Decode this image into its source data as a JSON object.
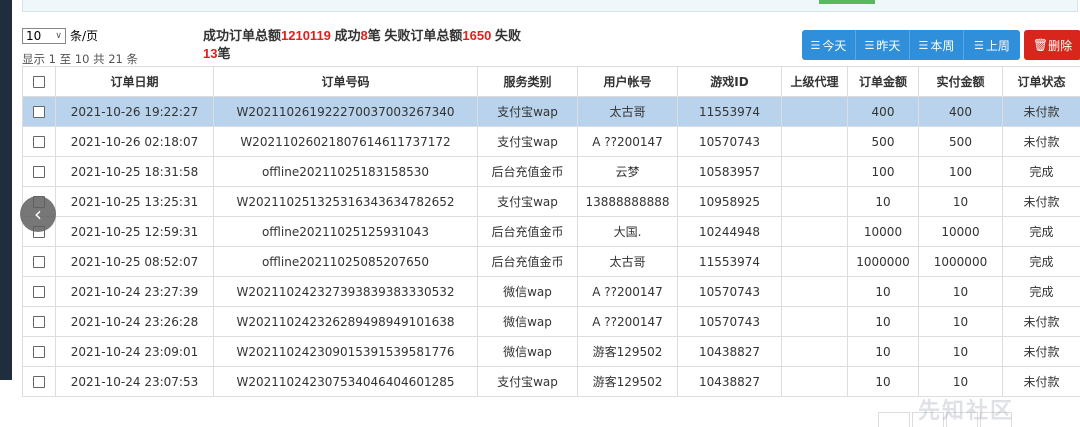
{
  "page_size": {
    "value": "10",
    "label": "条/页"
  },
  "record_info": "显示 1 至 10 共 21 条",
  "summary": {
    "t1": "成功订单总额",
    "success_amount": "1210119",
    "t2": " 成功",
    "success_count": "8",
    "t3": "笔 失败订单总额",
    "fail_amount": "1650",
    "t4": " 失败",
    "fail_count": "13",
    "t5": "笔"
  },
  "filters": {
    "today": "今天",
    "yesterday": "昨天",
    "this_week": "本周",
    "last_week": "上周"
  },
  "delete_label": "删除",
  "columns": [
    "订单日期",
    "订单号码",
    "服务类别",
    "用户帐号",
    "游戏ID",
    "上级代理",
    "订单金额",
    "实付金额",
    "订单状态"
  ],
  "rows": [
    {
      "date": "2021-10-26 19:22:27",
      "order_no": "W20211026192227003700326734​0",
      "service": "支付宝wap",
      "account": "太古哥",
      "game_id": "11553974",
      "agent": "",
      "amount": "400",
      "paid": "400",
      "status": "未付款",
      "status_kind": "unpaid"
    },
    {
      "date": "2021-10-26 02:18:07",
      "order_no": "W20211026021807614611737172",
      "service": "支付宝wap",
      "account": "A ??200147",
      "game_id": "10570743",
      "agent": "",
      "amount": "500",
      "paid": "500",
      "status": "未付款",
      "status_kind": "unpaid"
    },
    {
      "date": "2021-10-25 18:31:58",
      "order_no": "offline20211025183158530",
      "service": "后台充值金币",
      "account": "云梦",
      "game_id": "10583957",
      "agent": "",
      "amount": "100",
      "paid": "100",
      "status": "完成",
      "status_kind": "done"
    },
    {
      "date": "2021-10-25 13:25:31",
      "order_no": "W20211025132531634363478265​2",
      "service": "支付宝wap",
      "account": "13888888888",
      "game_id": "10958925",
      "agent": "",
      "amount": "10",
      "paid": "10",
      "status": "未付款",
      "status_kind": "unpaid"
    },
    {
      "date": "2021-10-25 12:59:31",
      "order_no": "offline20211025125931043",
      "service": "后台充值金币",
      "account": "大国.",
      "game_id": "10244948",
      "agent": "",
      "amount": "10000",
      "paid": "10000",
      "status": "完成",
      "status_kind": "done"
    },
    {
      "date": "2021-10-25 08:52:07",
      "order_no": "offline20211025085207650",
      "service": "后台充值金币",
      "account": "太古哥",
      "game_id": "11553974",
      "agent": "",
      "amount": "1000000",
      "paid": "1000000",
      "status": "完成",
      "status_kind": "done"
    },
    {
      "date": "2021-10-24 23:27:39",
      "order_no": "W20211024232739383938333053​2",
      "service": "微信wap",
      "account": "A ??200147",
      "game_id": "10570743",
      "agent": "",
      "amount": "10",
      "paid": "10",
      "status": "完成",
      "status_kind": "done"
    },
    {
      "date": "2021-10-24 23:26:28",
      "order_no": "W20211024232628949894910163​8",
      "service": "微信wap",
      "account": "A ??200147",
      "game_id": "10570743",
      "agent": "",
      "amount": "10",
      "paid": "10",
      "status": "未付款",
      "status_kind": "unpaid"
    },
    {
      "date": "2021-10-24 23:09:01",
      "order_no": "W20211024230901539153958177​6",
      "service": "微信wap",
      "account": "游客129502",
      "game_id": "10438827",
      "agent": "",
      "amount": "10",
      "paid": "10",
      "status": "未付款",
      "status_kind": "unpaid"
    },
    {
      "date": "2021-10-24 23:07:53",
      "order_no": "W20211024230753404640460128​5",
      "service": "支付宝wap",
      "account": "游客129502",
      "game_id": "10438827",
      "agent": "",
      "amount": "10",
      "paid": "10",
      "status": "未付款",
      "status_kind": "unpaid"
    }
  ],
  "watermark": "先知社区",
  "colors": {
    "primary_button": "#2f8fdb",
    "delete_button": "#d9261c",
    "selected_row": "#b8d3eb",
    "link": "#1a6fc9",
    "unpaid": "#e0201c",
    "done": "#1e9b2c"
  },
  "icons": {
    "filter_buttons": "list-icon",
    "delete": "trash-icon",
    "nav_arrow": "chevron-left-icon"
  }
}
